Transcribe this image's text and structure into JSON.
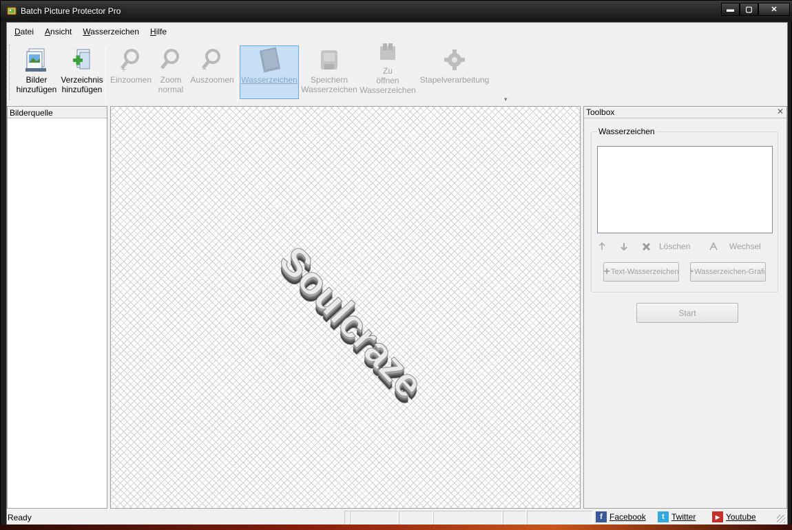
{
  "window": {
    "title": "Batch Picture Protector Pro",
    "controls": {
      "minimize": "▬",
      "maximize": "▢",
      "close": "✕"
    }
  },
  "menu": [
    {
      "label": "Datei",
      "mnemonic": "D",
      "rest": "atei"
    },
    {
      "label": "Ansicht",
      "mnemonic": "A",
      "rest": "nsicht"
    },
    {
      "label": "Wasserzeichen",
      "mnemonic": "W",
      "rest": "asserzeichen"
    },
    {
      "label": "Hilfe",
      "mnemonic": "H",
      "rest": "ilfe"
    }
  ],
  "toolbar": {
    "add_images": {
      "line1": "Bilder",
      "line2": "hinzufügen",
      "icon": "images-icon"
    },
    "add_folder": {
      "line1": "Verzeichnis",
      "line2": "hinzufügen",
      "icon": "folder-add-icon"
    },
    "zoom_in": {
      "line1": "Einzoomen",
      "icon": "zoom-in-icon"
    },
    "zoom_normal": {
      "line1": "Zoom",
      "line2": "normal",
      "icon": "zoom-normal-icon"
    },
    "zoom_out": {
      "line1": "Auszoomen",
      "icon": "zoom-out-icon"
    },
    "watermark": {
      "line1": "Wasserzeichen",
      "icon": "watermark-icon"
    },
    "save_watermark": {
      "line1": "Speichern",
      "line2": "Wasserzeichen",
      "icon": "save-icon"
    },
    "open_watermark": {
      "line1": "Zu",
      "line2": "öffnen",
      "line3": "Wasserzeichen",
      "icon": "open-icon"
    },
    "batch": {
      "line1": "Stapelverarbeitung",
      "icon": "gear-icon"
    },
    "overflow": "▾"
  },
  "left_panel": {
    "header": "Bilderquelle"
  },
  "canvas": {
    "watermark_text": "Soulcraze"
  },
  "toolbox": {
    "header": "Toolbox",
    "close": "✕",
    "group_title": "Wasserzeichen",
    "actions": {
      "delete": "Löschen",
      "switch": "Wechsel"
    },
    "text_watermark_button": "Text-Wasserzeichen",
    "graphic_watermark_button": "Wasserzeichen-Grafik",
    "start_button": "Start"
  },
  "status": {
    "text": "Ready",
    "links": [
      {
        "label": "Facebook",
        "icon": "facebook-icon",
        "glyph": "f",
        "color": "#3b5998"
      },
      {
        "label": "Twitter",
        "icon": "twitter-icon",
        "glyph": "t",
        "color": "#33a9e0"
      },
      {
        "label": "Youtube",
        "icon": "youtube-icon",
        "glyph": "▶",
        "color": "#c4302b"
      }
    ]
  }
}
